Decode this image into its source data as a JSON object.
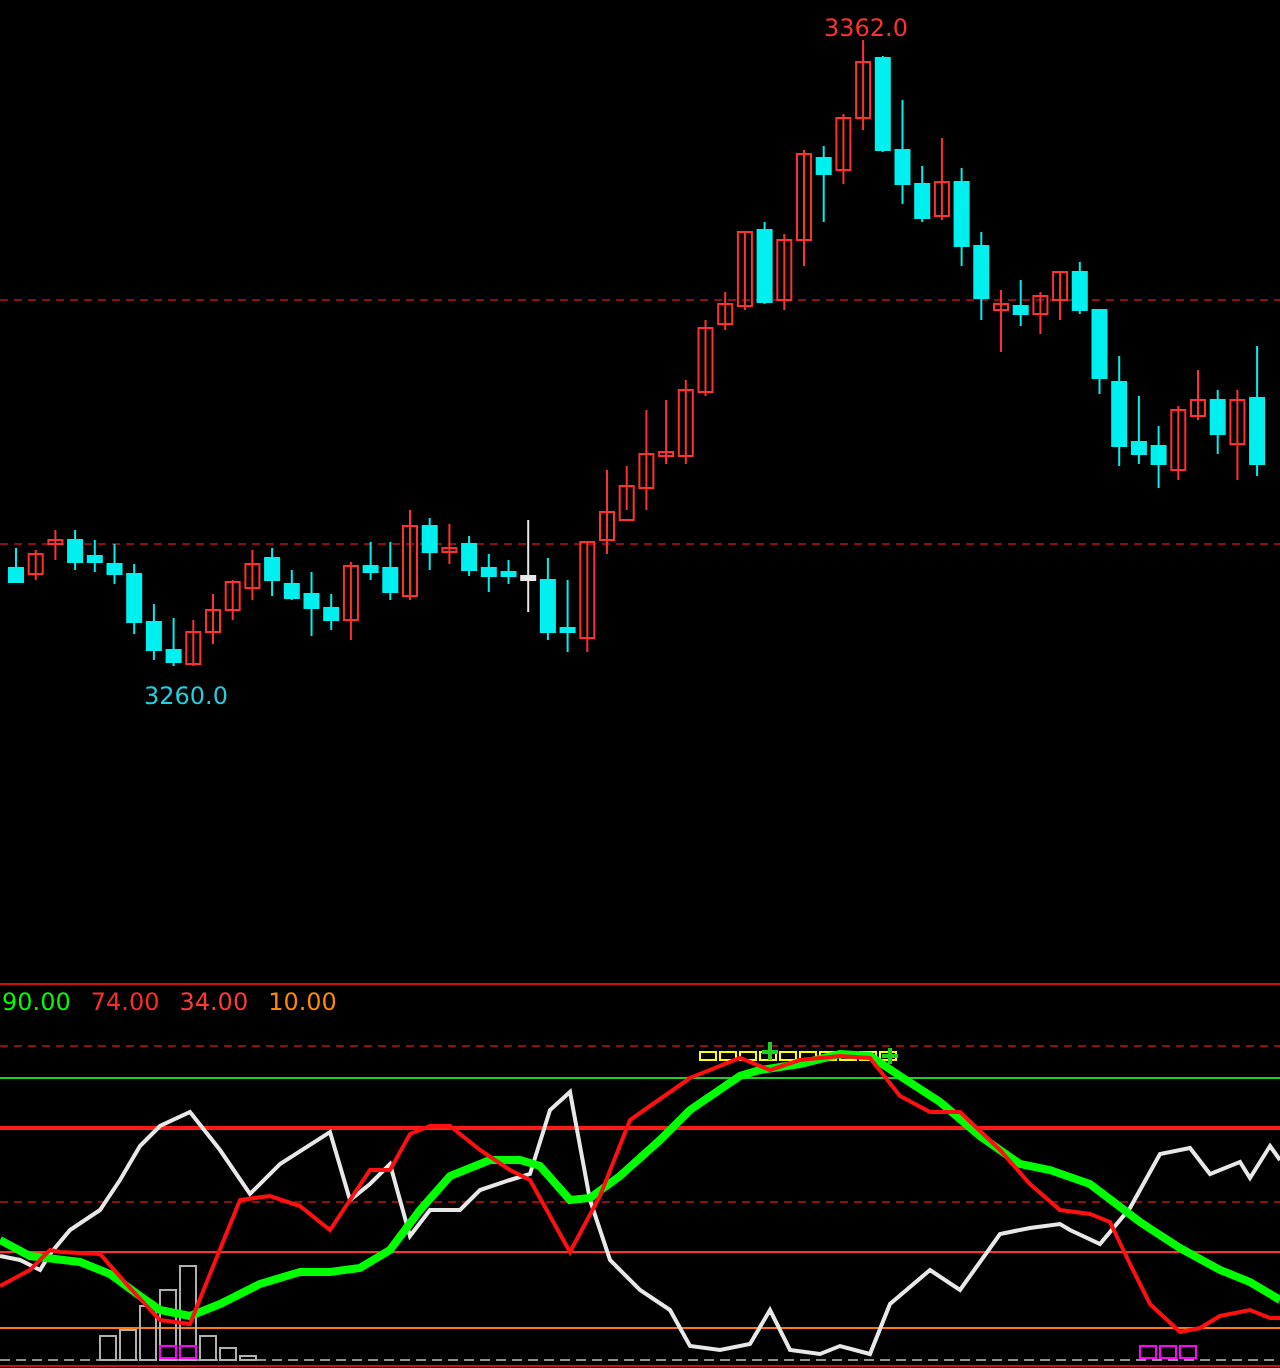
{
  "price_chart": {
    "high_label": "3362.0",
    "low_label": "3260.0"
  },
  "indicator": {
    "legend": [
      {
        "value": "90.00",
        "color": "#00ff00"
      },
      {
        "value": "74.00",
        "color": "#ff2a2a"
      },
      {
        "value": "34.00",
        "color": "#ff3a3a"
      },
      {
        "value": "10.00",
        "color": "#ff8a00"
      }
    ]
  }
}
